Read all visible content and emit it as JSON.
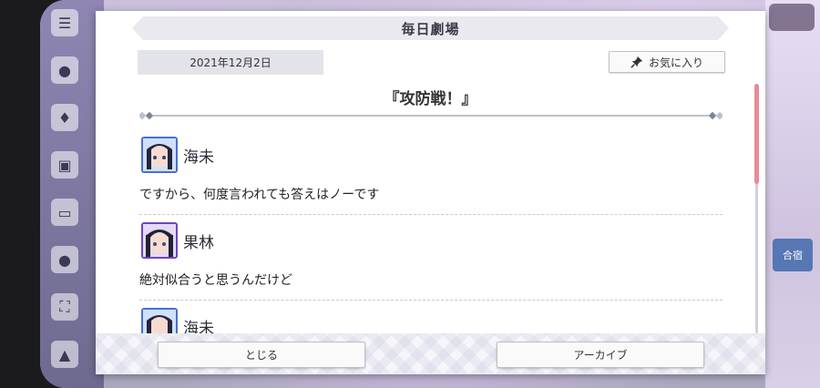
{
  "modal": {
    "title": "毎日劇場",
    "date": "2021年12月2日",
    "favorite_label": "お気に入り",
    "episode_title": "『攻防戦！』"
  },
  "entries": [
    {
      "speaker": "海未",
      "line": "ですから、何度言われても答えはノーです",
      "avatar_color": "#4a6ed1"
    },
    {
      "speaker": "果林",
      "line": "絶対似合うと思うんだけど",
      "avatar_color": "#6a48b8"
    },
    {
      "speaker": "海未",
      "line": "",
      "avatar_color": "#4a6ed1"
    }
  ],
  "buttons": {
    "close_label": "とじる",
    "archive_label": "アーカイブ"
  },
  "background": {
    "right_chip_label": "合宿"
  },
  "colors": {
    "accent_scroll": "#e98a9a",
    "title_bar": "#e9e9ef"
  }
}
